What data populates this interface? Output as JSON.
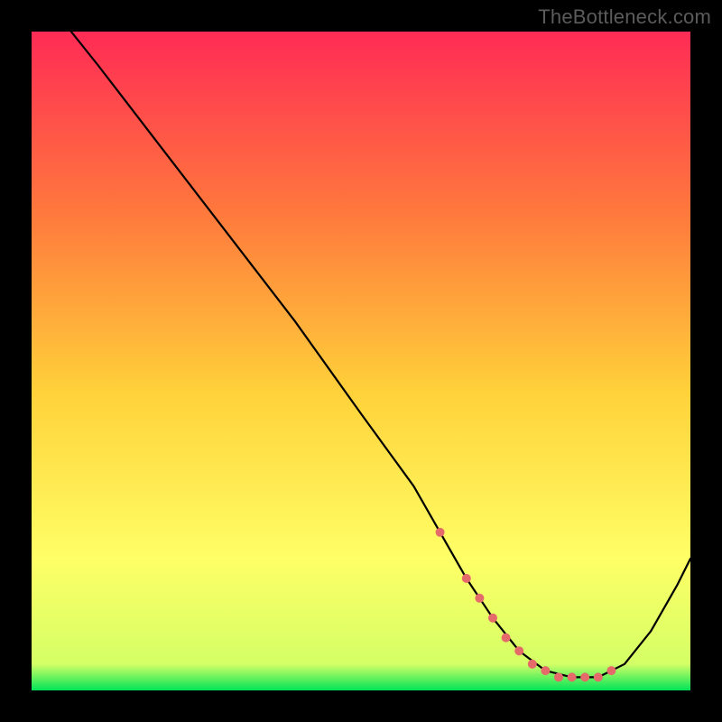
{
  "watermark": "TheBottleneck.com",
  "colors": {
    "frame": "#000000",
    "gradient_top": "#ff2b55",
    "gradient_mid1": "#ff7a3c",
    "gradient_mid2": "#ffd23a",
    "gradient_mid3": "#ffff66",
    "gradient_bottom": "#00e457",
    "curve": "#000000",
    "marker": "#e56a6a"
  },
  "chart_data": {
    "type": "line",
    "title": "",
    "xlabel": "",
    "ylabel": "",
    "xlim": [
      0,
      100
    ],
    "ylim": [
      0,
      100
    ],
    "series": [
      {
        "name": "bottleneck-curve",
        "x": [
          6,
          10,
          20,
          30,
          40,
          50,
          58,
          62,
          66,
          70,
          74,
          78,
          82,
          86,
          90,
          94,
          98,
          100
        ],
        "values": [
          100,
          95,
          82,
          69,
          56,
          42,
          31,
          24,
          17,
          11,
          6,
          3,
          2,
          2,
          4,
          9,
          16,
          20
        ]
      }
    ],
    "markers": {
      "name": "highlight-dots",
      "x": [
        62,
        66,
        68,
        70,
        72,
        74,
        76,
        78,
        80,
        82,
        84,
        86,
        88
      ],
      "values": [
        24,
        17,
        14,
        11,
        8,
        6,
        4,
        3,
        2,
        2,
        2,
        2,
        3
      ]
    }
  }
}
